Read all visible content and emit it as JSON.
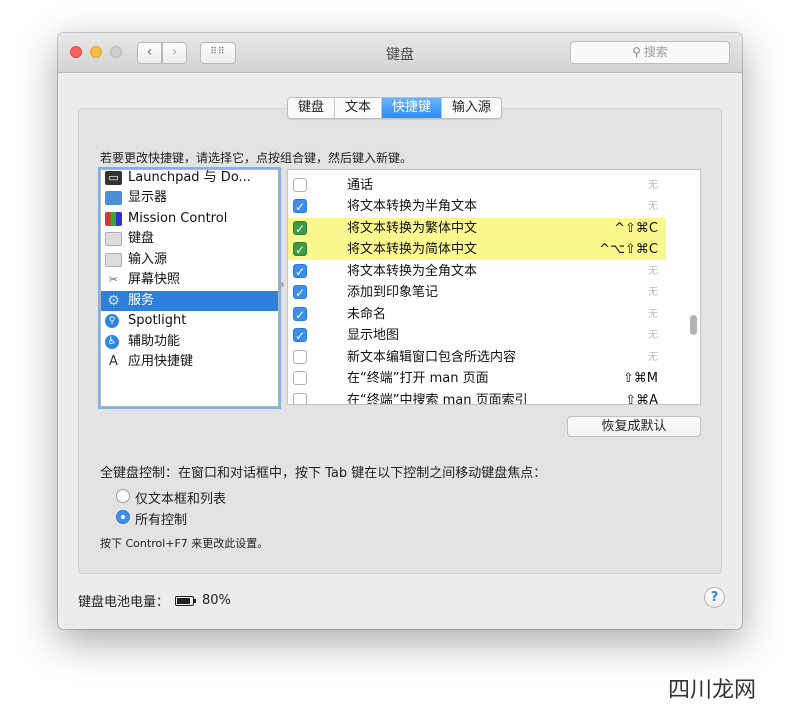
{
  "window": {
    "title": "键盘",
    "search_placeholder": "搜索",
    "nav_back": "‹",
    "nav_forward": "›",
    "grid": "⠿⠿"
  },
  "tabs": [
    {
      "label": "键盘",
      "active": false
    },
    {
      "label": "文本",
      "active": false
    },
    {
      "label": "快捷键",
      "active": true
    },
    {
      "label": "输入源",
      "active": false
    }
  ],
  "instructions": "若要更改快捷键，请选择它，点按组合键，然后键入新键。",
  "categories": [
    {
      "label": "Launchpad 与 Do...",
      "icon": "launchpad-icon",
      "selected": false
    },
    {
      "label": "显示器",
      "icon": "display-icon",
      "selected": false
    },
    {
      "label": "Mission Control",
      "icon": "mission-control-icon",
      "selected": false
    },
    {
      "label": "键盘",
      "icon": "keyboard-icon",
      "selected": false
    },
    {
      "label": "输入源",
      "icon": "input-source-icon",
      "selected": false
    },
    {
      "label": "屏幕快照",
      "icon": "screenshot-icon",
      "selected": false
    },
    {
      "label": "服务",
      "icon": "services-gear-icon",
      "selected": true
    },
    {
      "label": "Spotlight",
      "icon": "spotlight-icon",
      "selected": false
    },
    {
      "label": "辅助功能",
      "icon": "accessibility-icon",
      "selected": false
    },
    {
      "label": "应用快捷键",
      "icon": "app-shortcuts-icon",
      "selected": false
    }
  ],
  "shortcuts": [
    {
      "name": "通话",
      "checked": false,
      "key": "无",
      "highlight": false
    },
    {
      "name": "将文本转换为半角文本",
      "checked": true,
      "key": "无",
      "highlight": false
    },
    {
      "name": "将文本转换为繁体中文",
      "checked": true,
      "key": "^⇧⌘C",
      "highlight": true
    },
    {
      "name": "将文本转换为简体中文",
      "checked": true,
      "key": "^⌥⇧⌘C",
      "highlight": true
    },
    {
      "name": "将文本转换为全角文本",
      "checked": true,
      "key": "无",
      "highlight": false
    },
    {
      "name": "添加到印象笔记",
      "checked": true,
      "key": "无",
      "highlight": false
    },
    {
      "name": "未命名",
      "checked": true,
      "key": "无",
      "highlight": false
    },
    {
      "name": "显示地图",
      "checked": true,
      "key": "无",
      "highlight": false
    },
    {
      "name": "新文本编辑窗口包含所选内容",
      "checked": false,
      "key": "无",
      "highlight": false
    },
    {
      "name": "在“终端”打开 man 页面",
      "checked": false,
      "key": "⇧⌘M",
      "highlight": false
    },
    {
      "name": "在“终端”中搜索 man 页面索引",
      "checked": false,
      "key": "⇧⌘A",
      "highlight": false
    }
  ],
  "restore_button": "恢复成默认",
  "full_keyboard": {
    "label": "全键盘控制：在窗口和对话框中，按下 Tab 键在以下控制之间移动键盘焦点：",
    "options": [
      {
        "label": "仅文本框和列表",
        "selected": false
      },
      {
        "label": "所有控制",
        "selected": true
      }
    ],
    "hint": "按下 Control+F7 来更改此设置。"
  },
  "battery": {
    "label": "键盘电池电量：",
    "value": "80%"
  },
  "help": "?",
  "watermark": "四川龙网"
}
